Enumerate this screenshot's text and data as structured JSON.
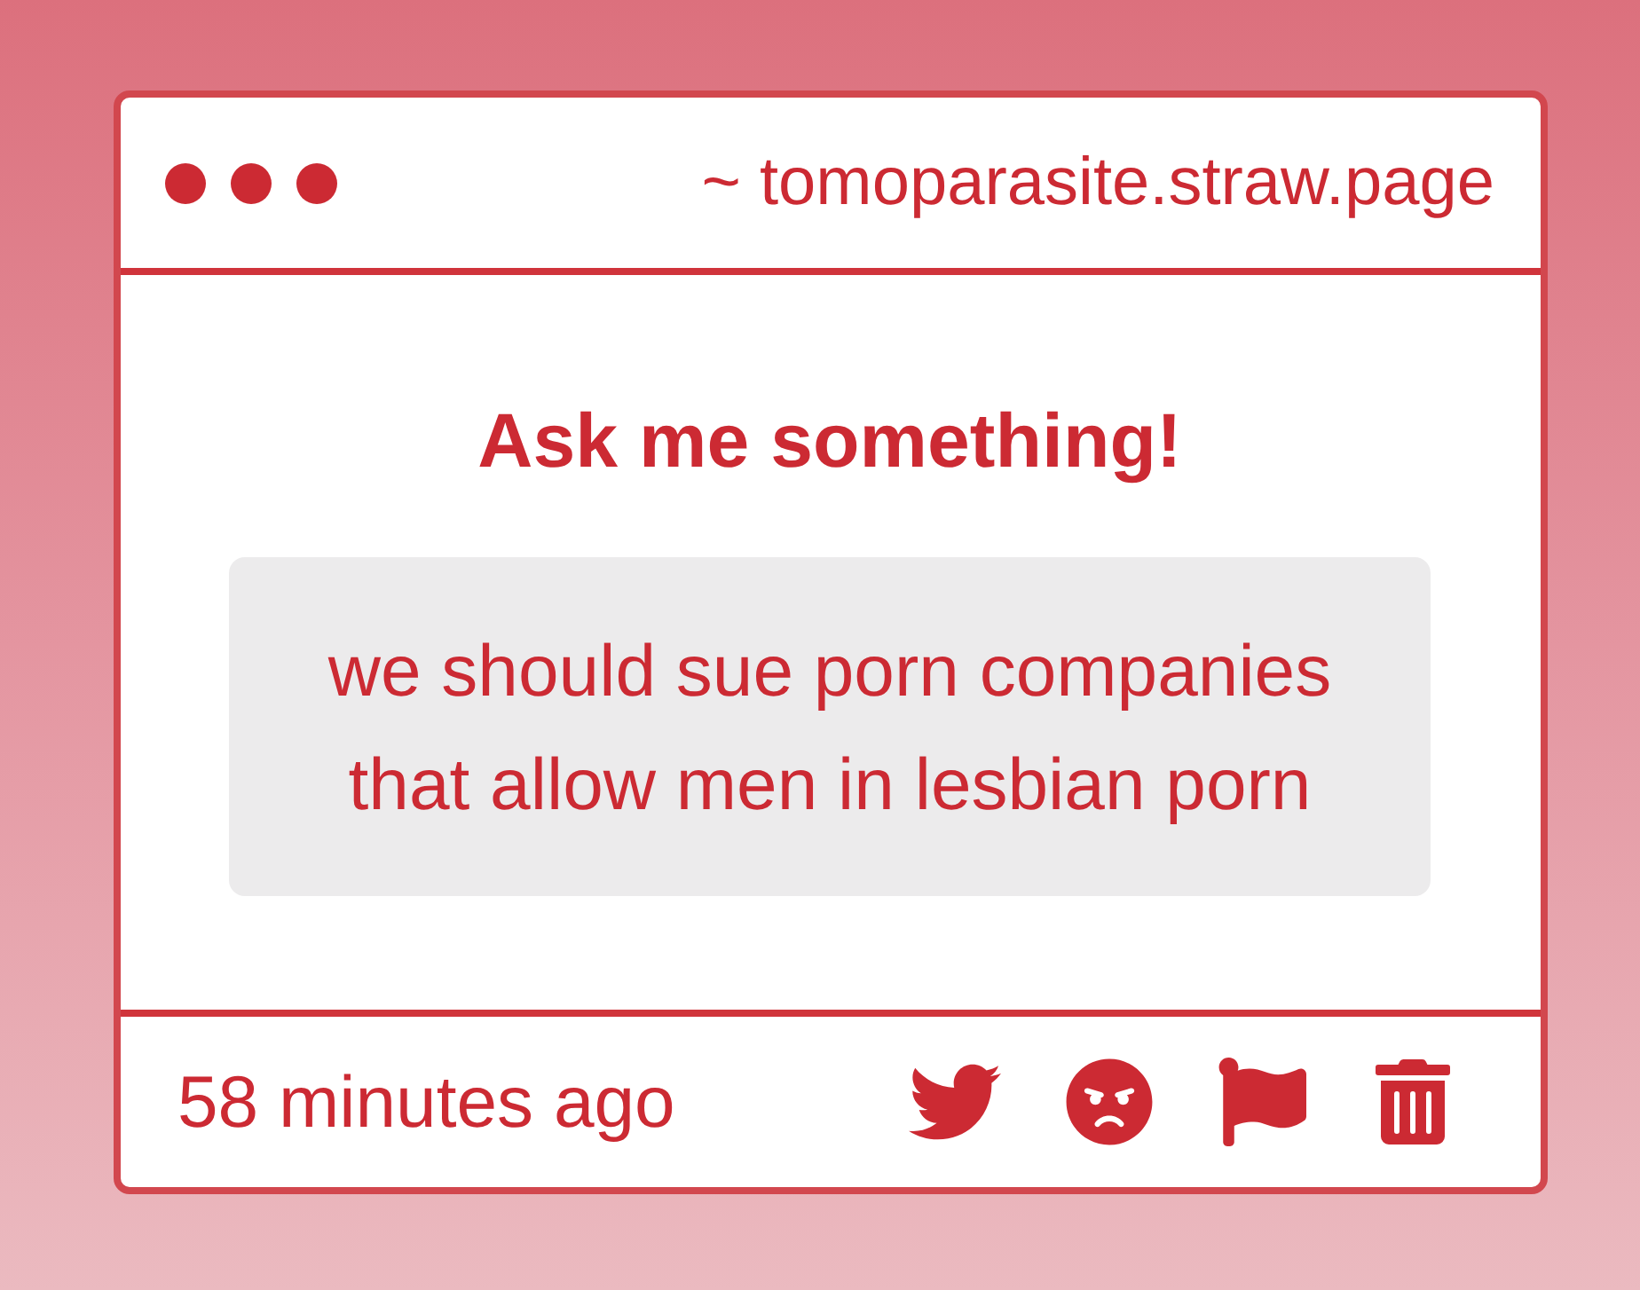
{
  "window": {
    "address": "~ tomoparasite.straw.page"
  },
  "prompt": {
    "title": "Ask me something!"
  },
  "question": {
    "text": "we should sue porn companies that allow men in lesbian porn"
  },
  "footer": {
    "timestamp": "58 minutes ago",
    "actions": [
      {
        "kind": "tweet"
      },
      {
        "kind": "react"
      },
      {
        "kind": "report"
      },
      {
        "kind": "delete"
      }
    ]
  }
}
